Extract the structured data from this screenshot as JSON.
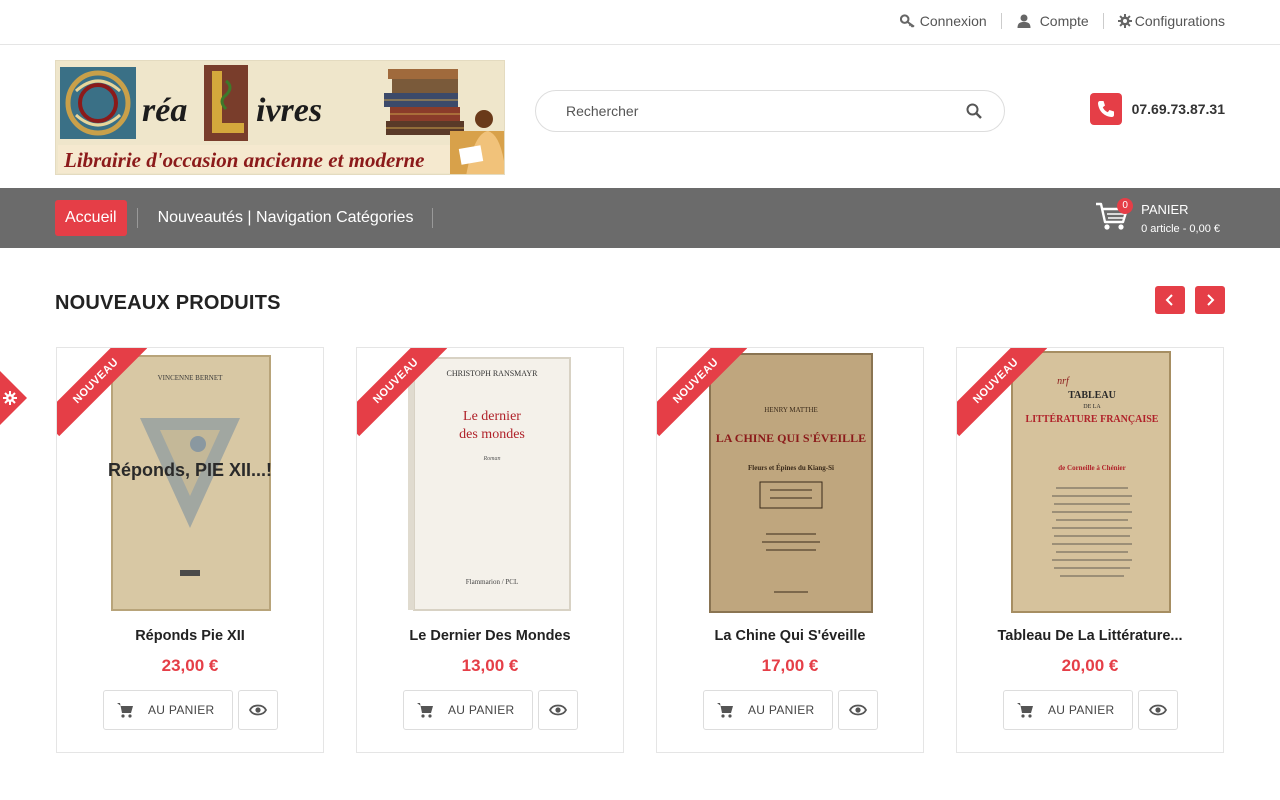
{
  "topbar": {
    "login": {
      "label": "Connexion",
      "icon": "key-icon"
    },
    "account": {
      "label": "Compte",
      "icon": "user-icon"
    },
    "settings": {
      "label": "Configurations",
      "icon": "gear-icon"
    }
  },
  "header": {
    "logo": {
      "brand_main": "réa  ivres",
      "brand_initials": [
        "C",
        "L"
      ],
      "tagline": "Librairie d'occasion ancienne et moderne"
    },
    "search": {
      "placeholder": "Rechercher",
      "icon": "search-icon"
    },
    "phone": {
      "number": "07.69.73.87.31",
      "icon": "phone-icon"
    }
  },
  "nav": {
    "home": "Accueil",
    "links": [
      "Nouveautés | Navigation Catégories"
    ]
  },
  "cart": {
    "count": "0",
    "title": "PANIER",
    "summary": "0 article - 0,00 €",
    "icon": "shopping-cart-icon"
  },
  "section": {
    "title": "NOUVEAUX PRODUITS",
    "prev_icon": "chevron-left-icon",
    "next_icon": "chevron-right-icon"
  },
  "colors": {
    "accent": "#e53e47",
    "navbar": "#6b6b6b"
  },
  "products": [
    {
      "badge": "NOUVEAU",
      "name": "Réponds Pie XII",
      "price": "23,00 €",
      "add_label": "AU PANIER",
      "cover": {
        "author": "VINCENNE BERNET",
        "title": "Réponds, PIE XII...!",
        "publisher": ""
      }
    },
    {
      "badge": "NOUVEAU",
      "name": "Le Dernier Des Mondes",
      "price": "13,00 €",
      "add_label": "AU PANIER",
      "cover": {
        "author": "CHRISTOPH RANSMAYR",
        "title": "Le dernier des mondes",
        "publisher": "Flammarion / PCL"
      }
    },
    {
      "badge": "NOUVEAU",
      "name": "La Chine Qui S'éveille",
      "price": "17,00 €",
      "add_label": "AU PANIER",
      "cover": {
        "author": "HENRY MATTHE",
        "title": "LA CHINE QUI S'ÉVEILLE",
        "publisher": "Fleurs et Épines du Kiang-Si"
      }
    },
    {
      "badge": "NOUVEAU",
      "name": "Tableau De La Littérature...",
      "price": "20,00 €",
      "add_label": "AU PANIER",
      "cover": {
        "author": "nrf",
        "title": "TABLEAU DE LA LITTÉRATURE FRANÇAISE",
        "publisher": "de Corneille à Chénier"
      }
    }
  ]
}
